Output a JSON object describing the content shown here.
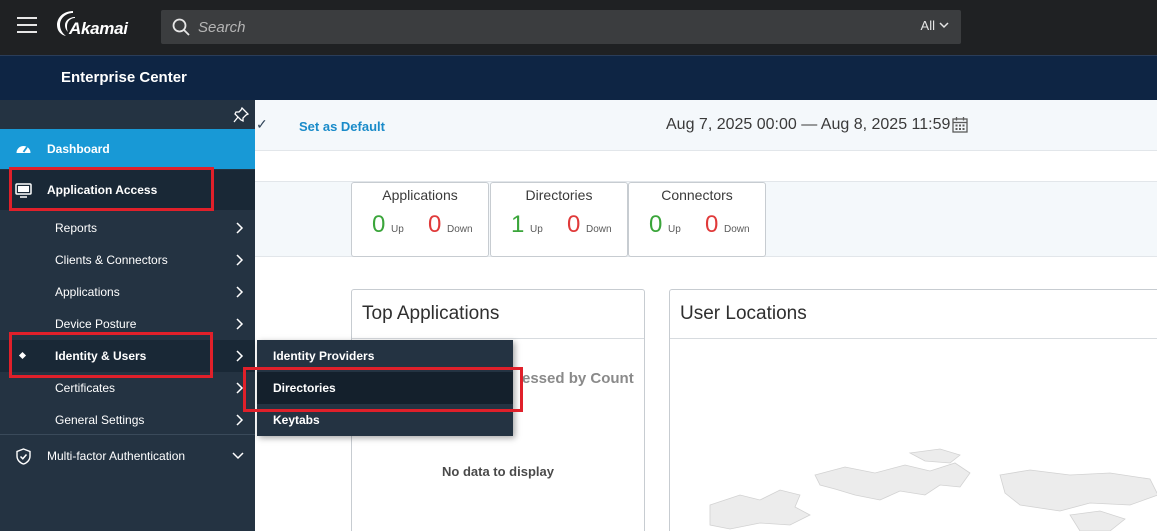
{
  "header": {
    "logo_text": "Akamai",
    "search_placeholder": "Search",
    "search_scope": "All",
    "product_title": "Enterprise Center"
  },
  "toolbar": {
    "set_default_label": "Set as Default",
    "date_range": "Aug 7, 2025 00:00 — Aug 8, 2025 11:59"
  },
  "stats": [
    {
      "title": "Applications",
      "up": "0",
      "up_label": "Up",
      "down": "0",
      "down_label": "Down"
    },
    {
      "title": "Directories",
      "up": "1",
      "up_label": "Up",
      "down": "0",
      "down_label": "Down"
    },
    {
      "title": "Connectors",
      "up": "0",
      "up_label": "Up",
      "down": "0",
      "down_label": "Down"
    }
  ],
  "panels": {
    "top_applications": {
      "title": "Top Applications",
      "subtitle_visible": "essed by Count",
      "empty_text": "No data to display"
    },
    "user_locations": {
      "title": "User Locations"
    }
  },
  "sidebar": {
    "dashboard": "Dashboard",
    "application_access": "Application Access",
    "items": [
      {
        "label": "Reports"
      },
      {
        "label": "Clients & Connectors"
      },
      {
        "label": "Applications"
      },
      {
        "label": "Device Posture"
      },
      {
        "label": "Identity & Users"
      },
      {
        "label": "Certificates"
      },
      {
        "label": "General Settings"
      }
    ],
    "mfa": "Multi-factor Authentication"
  },
  "flyout": {
    "items": [
      {
        "label": "Identity Providers"
      },
      {
        "label": "Directories"
      },
      {
        "label": "Keytabs"
      }
    ]
  },
  "colors": {
    "accent": "#1899d6",
    "highlight": "#e0202a",
    "up": "#3aa53a",
    "down": "#e03a3a"
  }
}
